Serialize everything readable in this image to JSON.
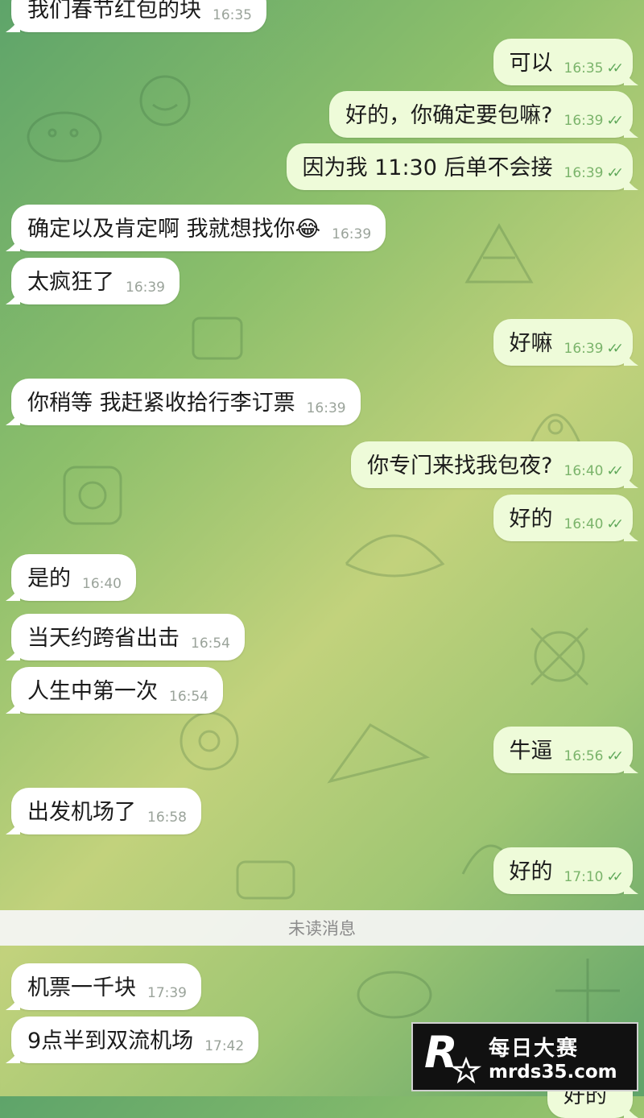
{
  "messages": [
    {
      "dir": "in",
      "text": "我们春节红包的块",
      "time": "16:35"
    },
    {
      "dir": "out",
      "text": "可以",
      "time": "16:35"
    },
    {
      "dir": "out",
      "text": "好的，你确定要包嘛?",
      "time": "16:39"
    },
    {
      "dir": "out",
      "text": "因为我 11:30 后单不会接",
      "time": "16:39"
    },
    {
      "dir": "in",
      "text": "确定以及肯定啊 我就想找你😂",
      "time": "16:39"
    },
    {
      "dir": "in",
      "text": "太疯狂了",
      "time": "16:39"
    },
    {
      "dir": "out",
      "text": "好嘛",
      "time": "16:39"
    },
    {
      "dir": "in",
      "text": "你稍等 我赶紧收拾行李订票",
      "time": "16:39"
    },
    {
      "dir": "out",
      "text": "你专门来找我包夜?",
      "time": "16:40"
    },
    {
      "dir": "out",
      "text": "好的",
      "time": "16:40"
    },
    {
      "dir": "in",
      "text": "是的",
      "time": "16:40"
    },
    {
      "dir": "in",
      "text": "当天约跨省出击",
      "time": "16:54"
    },
    {
      "dir": "in",
      "text": "人生中第一次",
      "time": "16:54"
    },
    {
      "dir": "out",
      "text": "牛逼",
      "time": "16:56"
    },
    {
      "dir": "in",
      "text": "出发机场了",
      "time": "16:58"
    },
    {
      "dir": "out",
      "text": "好的",
      "time": "17:10"
    },
    {
      "dir": "in",
      "text": "机票一千块",
      "time": "17:39"
    },
    {
      "dir": "in",
      "text": "9点半到双流机场",
      "time": "17:42"
    },
    {
      "dir": "out",
      "text": "好的",
      "time": ""
    }
  ],
  "unread_divider": "未读消息",
  "read_ticks": "✓✓",
  "watermark": {
    "logo_letter": "R",
    "logo_sub": "每日大赛",
    "name": "每日大赛",
    "url": "mrds35.com"
  },
  "colors": {
    "incoming_bubble": "#ffffff",
    "outgoing_bubble": "#eefbd9",
    "tick": "#5fa85a"
  }
}
